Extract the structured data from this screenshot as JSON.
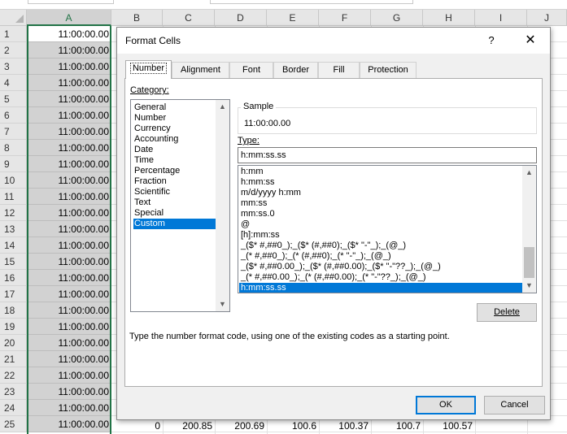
{
  "sheet": {
    "columns": [
      "A",
      "B",
      "C",
      "D",
      "E",
      "F",
      "G",
      "H",
      "I",
      "J"
    ],
    "rows": [
      "1",
      "2",
      "3",
      "4",
      "5",
      "6",
      "7",
      "8",
      "9",
      "10",
      "11",
      "12",
      "13",
      "14",
      "15",
      "16",
      "17",
      "18",
      "19",
      "20",
      "21",
      "22",
      "23",
      "24",
      "25"
    ],
    "a_values": [
      "11:00:00.00",
      "11:00:00.00",
      "11:00:00.00",
      "11:00:00.00",
      "11:00:00.00",
      "11:00:00.00",
      "11:00:00.00",
      "11:00:00.00",
      "11:00:00.00",
      "11:00:00.00",
      "11:00:00.00",
      "11:00:00.00",
      "11:00:00.00",
      "11:00:00.00",
      "11:00:00.00",
      "11:00:00.00",
      "11:00:00.00",
      "11:00:00.00",
      "11:00:00.00",
      "11:00:00.00",
      "11:00:00.00",
      "11:00:00.00",
      "11:00:00.00",
      "11:00:00.00",
      "11:00:00.00"
    ],
    "row25": [
      "0",
      "200.85",
      "200.69",
      "100.6",
      "100.37",
      "100.7",
      "100.57"
    ],
    "accent": "#217346"
  },
  "dialog": {
    "title": "Format Cells",
    "help": "?",
    "close": "✕",
    "tabs": [
      "Number",
      "Alignment",
      "Font",
      "Border",
      "Fill",
      "Protection"
    ],
    "category_label": "Category:",
    "categories": [
      "General",
      "Number",
      "Currency",
      "Accounting",
      "Date",
      "Time",
      "Percentage",
      "Fraction",
      "Scientific",
      "Text",
      "Special",
      "Custom"
    ],
    "selected_category": "Custom",
    "sample_label": "Sample",
    "sample_value": "11:00:00.00",
    "type_label": "Type:",
    "type_value": "h:mm:ss.ss",
    "type_list": [
      "h:mm",
      "h:mm:ss",
      "m/d/yyyy h:mm",
      "mm:ss",
      "mm:ss.0",
      "@",
      "[h]:mm:ss",
      "_($* #,##0_);_($* (#,##0);_($* \"-\"_);_(@_)",
      "_(* #,##0_);_(* (#,##0);_(* \"-\"_);_(@_)",
      "_($* #,##0.00_);_($* (#,##0.00);_($* \"-\"??_);_(@_)",
      "_(* #,##0.00_);_(* (#,##0.00);_(* \"-\"??_);_(@_)",
      "h:mm:ss.ss"
    ],
    "delete_label": "Delete",
    "hint": "Type the number format code, using one of the existing codes as a starting point.",
    "ok_label": "OK",
    "cancel_label": "Cancel",
    "selection_color": "#0078d7"
  },
  "icons": {
    "scroll_up": "▲",
    "scroll_down": "▼",
    "help": "question-icon",
    "close": "close-icon"
  }
}
